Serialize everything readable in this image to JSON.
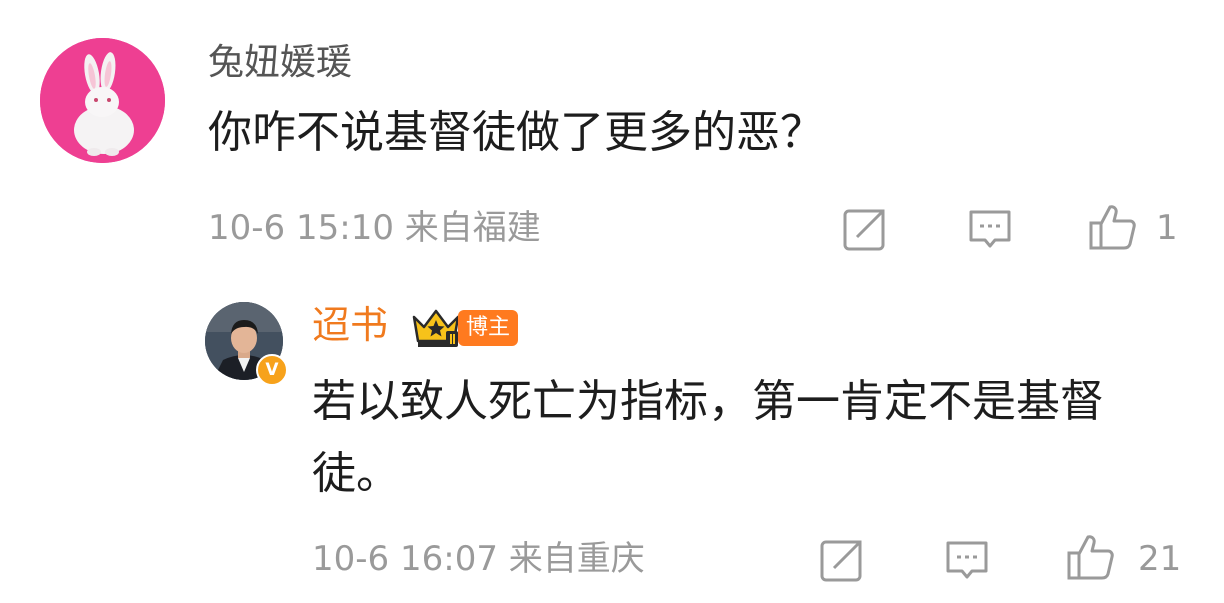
{
  "comment": {
    "username": "兔妞媛瑗",
    "text": "你咋不说基督徒做了更多的恶？",
    "meta": "10-6 15:10 来自福建",
    "like_count": "1",
    "avatar_icon": "white-rabbit-avatar"
  },
  "reply": {
    "username": "迢书",
    "badge_label": "博主",
    "verified_mark": "V",
    "text": "若以致人死亡为指标，第一肯定不是基督徒。",
    "meta": "10-6 16:07 来自重庆",
    "like_count": "21",
    "avatar_icon": "man-portrait-avatar"
  },
  "icons": {
    "share": "share-icon",
    "comment": "comment-icon",
    "like": "thumbs-up-icon",
    "crown": "crown-level-icon"
  },
  "colors": {
    "username_reply": "#f07a1e",
    "badge_bg": "#ff7a1f",
    "meta_text": "#9a9a9a",
    "avatar_bg": "#ee3f92"
  }
}
